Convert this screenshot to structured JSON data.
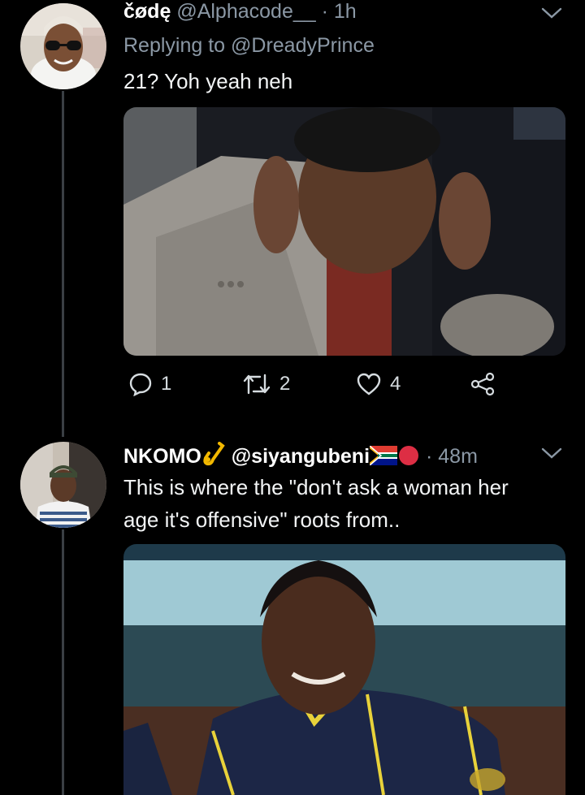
{
  "colors": {
    "background": "#000000",
    "muted": "#8b98a5",
    "thread_line": "#3a3f44"
  },
  "tweets": [
    {
      "display_name": "čødę",
      "handle": "@Alphacode__",
      "separator": "·",
      "time": "1h",
      "replying_to": "Replying to @DreadyPrince",
      "text": "21? Yoh yeah neh",
      "media_description": "photo",
      "actions": {
        "reply_count": "1",
        "retweet_count": "2",
        "like_count": "4"
      }
    },
    {
      "display_name": "NKOMO",
      "name_emoji": "🎷",
      "handle": "@siyangubeni",
      "handle_emoji_flag": "south-africa-flag",
      "handle_emoji_circle": "red-circle",
      "separator": "·",
      "time": "48m",
      "text_lines": [
        "This is where the \"don't ask a woman her",
        "age it's offensive\" roots from.."
      ],
      "media_description": "photo"
    }
  ]
}
